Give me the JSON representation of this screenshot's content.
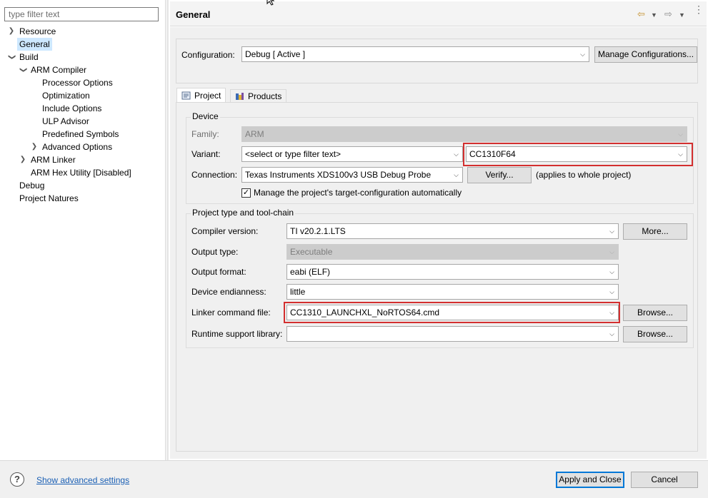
{
  "filter": {
    "placeholder": "type filter text"
  },
  "tree": {
    "resource": "Resource",
    "general": "General",
    "build": "Build",
    "arm_compiler": "ARM Compiler",
    "processor_options": "Processor Options",
    "optimization": "Optimization",
    "include_options": "Include Options",
    "ulp_advisor": "ULP Advisor",
    "predefined_symbols": "Predefined Symbols",
    "advanced_options": "Advanced Options",
    "arm_linker": "ARM Linker",
    "arm_hex_utility": "ARM Hex Utility  [Disabled]",
    "debug": "Debug",
    "project_natures": "Project Natures"
  },
  "header": {
    "title": "General"
  },
  "config": {
    "label": "Configuration:",
    "value": "Debug  [ Active ]",
    "manage_button": "Manage Configurations..."
  },
  "tabs": {
    "project": "Project",
    "products": "Products"
  },
  "device": {
    "group_title": "Device",
    "family_label": "Family:",
    "family_value": "ARM",
    "variant_label": "Variant:",
    "variant_filter": "<select or type filter text>",
    "variant_value": "CC1310F64",
    "connection_label": "Connection:",
    "connection_value": "Texas Instruments XDS100v3 USB Debug Probe",
    "verify_button": "Verify...",
    "applies_note": "(applies to whole project)",
    "manage_checkbox_label": "Manage the project's target-configuration automatically",
    "manage_checked": true
  },
  "toolchain": {
    "group_title": "Project type and tool-chain",
    "compiler_label": "Compiler version:",
    "compiler_value": "TI v20.2.1.LTS",
    "more_button": "More...",
    "output_type_label": "Output type:",
    "output_type_value": "Executable",
    "output_format_label": "Output format:",
    "output_format_value": "eabi (ELF)",
    "endianness_label": "Device endianness:",
    "endianness_value": "little",
    "linker_label": "Linker command file:",
    "linker_value": "CC1310_LAUNCHXL_NoRTOS64.cmd",
    "browse_button": "Browse...",
    "runtime_label": "Runtime support library:",
    "runtime_value": "",
    "browse_button_2": "Browse..."
  },
  "footer": {
    "help_glyph": "?",
    "advanced_link": "Show advanced settings",
    "apply_button": "Apply and Close",
    "cancel_button": "Cancel"
  },
  "colors": {
    "highlight": "#d32f2f",
    "selection": "#cde8ff",
    "link": "#1a5fb4",
    "default_button": "#0078d7"
  },
  "icons": [
    "help-icon",
    "back-arrow-icon",
    "forward-arrow-icon",
    "view-menu-icon",
    "project-tab-icon",
    "products-tab-icon",
    "chevron-down-icon",
    "checkbox-check-icon",
    "chevron-right-icon"
  ]
}
